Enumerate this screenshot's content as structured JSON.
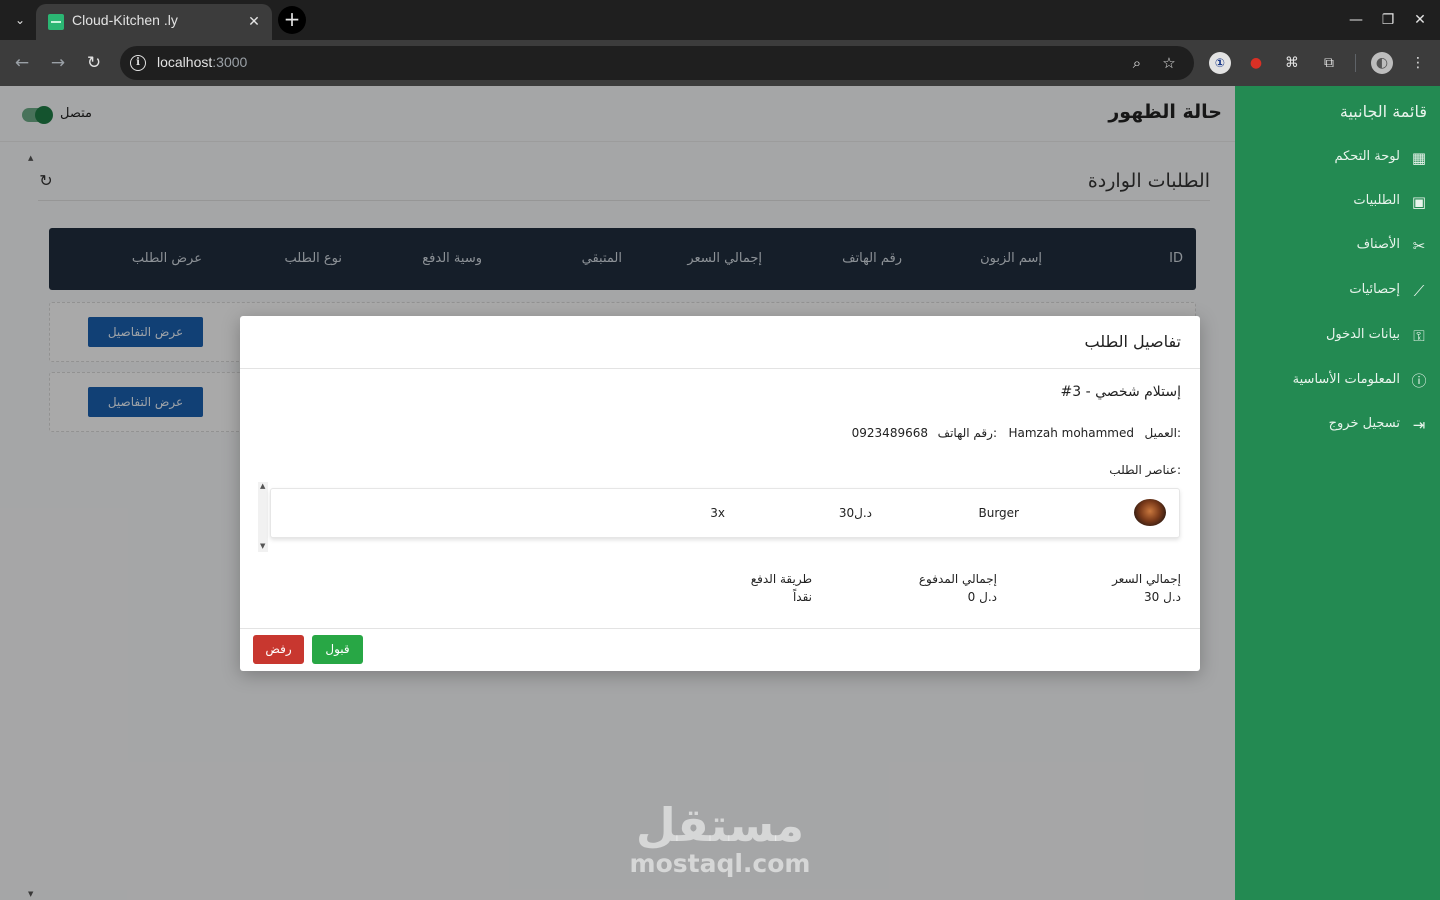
{
  "browser": {
    "tab_title": "Cloud-Kitchen .ly",
    "url_host": "localhost",
    "url_port": ":3000"
  },
  "header": {
    "page_title": "حالة الظهور",
    "status_label": "متصل",
    "status_on": true
  },
  "orders": {
    "title": "الطلبات الواردة",
    "columns": [
      "ID",
      "إسم الزبون",
      "رقم الهاتف",
      "إجمالي السعر",
      "المتبقي",
      "وسية الدفع",
      "نوع الطلب",
      "عرض الطلب"
    ],
    "rows": [
      {
        "details_label": "عرض التفاصيل"
      },
      {
        "details_label": "عرض التفاصيل"
      }
    ]
  },
  "sidebar": {
    "title": "قائمة الجانبية",
    "items": [
      {
        "label": "لوحة التحكم",
        "icon": "dashboard-icon"
      },
      {
        "label": "الطلبيات",
        "icon": "archive-icon"
      },
      {
        "label": "الأصناف",
        "icon": "utensils-icon"
      },
      {
        "label": "إحصائيات",
        "icon": "chart-icon"
      },
      {
        "label": "بيانات الدخول",
        "icon": "key-icon"
      },
      {
        "label": "المعلومات الأساسية",
        "icon": "info-icon"
      },
      {
        "label": "تسجيل خروج",
        "icon": "logout-icon"
      }
    ]
  },
  "modal": {
    "title": "تفاصيل الطلب",
    "order_heading": "#3 - إستلام شخصي",
    "customer_label": "العميل:",
    "customer_name": "Hamzah mohammed",
    "phone_label": "رقم الهاتف:",
    "phone_value": "0923489668",
    "items_label": "عناصر الطلب:",
    "items": [
      {
        "name": "Burger",
        "price": "30د.ل",
        "qty": "3x"
      }
    ],
    "summary": {
      "total_label": "إجمالي السعر",
      "total_value": "30 د.ل",
      "paid_label": "إجمالي المدفوع",
      "paid_value": "0 د.ل",
      "method_label": "طريقة الدفع",
      "method_value": "نقداً"
    },
    "accept_label": "قبول",
    "reject_label": "رفض"
  },
  "watermark": {
    "arabic": "مستقل",
    "latin": "mostaql.com"
  },
  "colors": {
    "sidebar": "#238a52",
    "table_header": "#1f2d3d",
    "primary_button": "#1a5fad",
    "accept": "#28a745",
    "reject": "#c8372f"
  }
}
